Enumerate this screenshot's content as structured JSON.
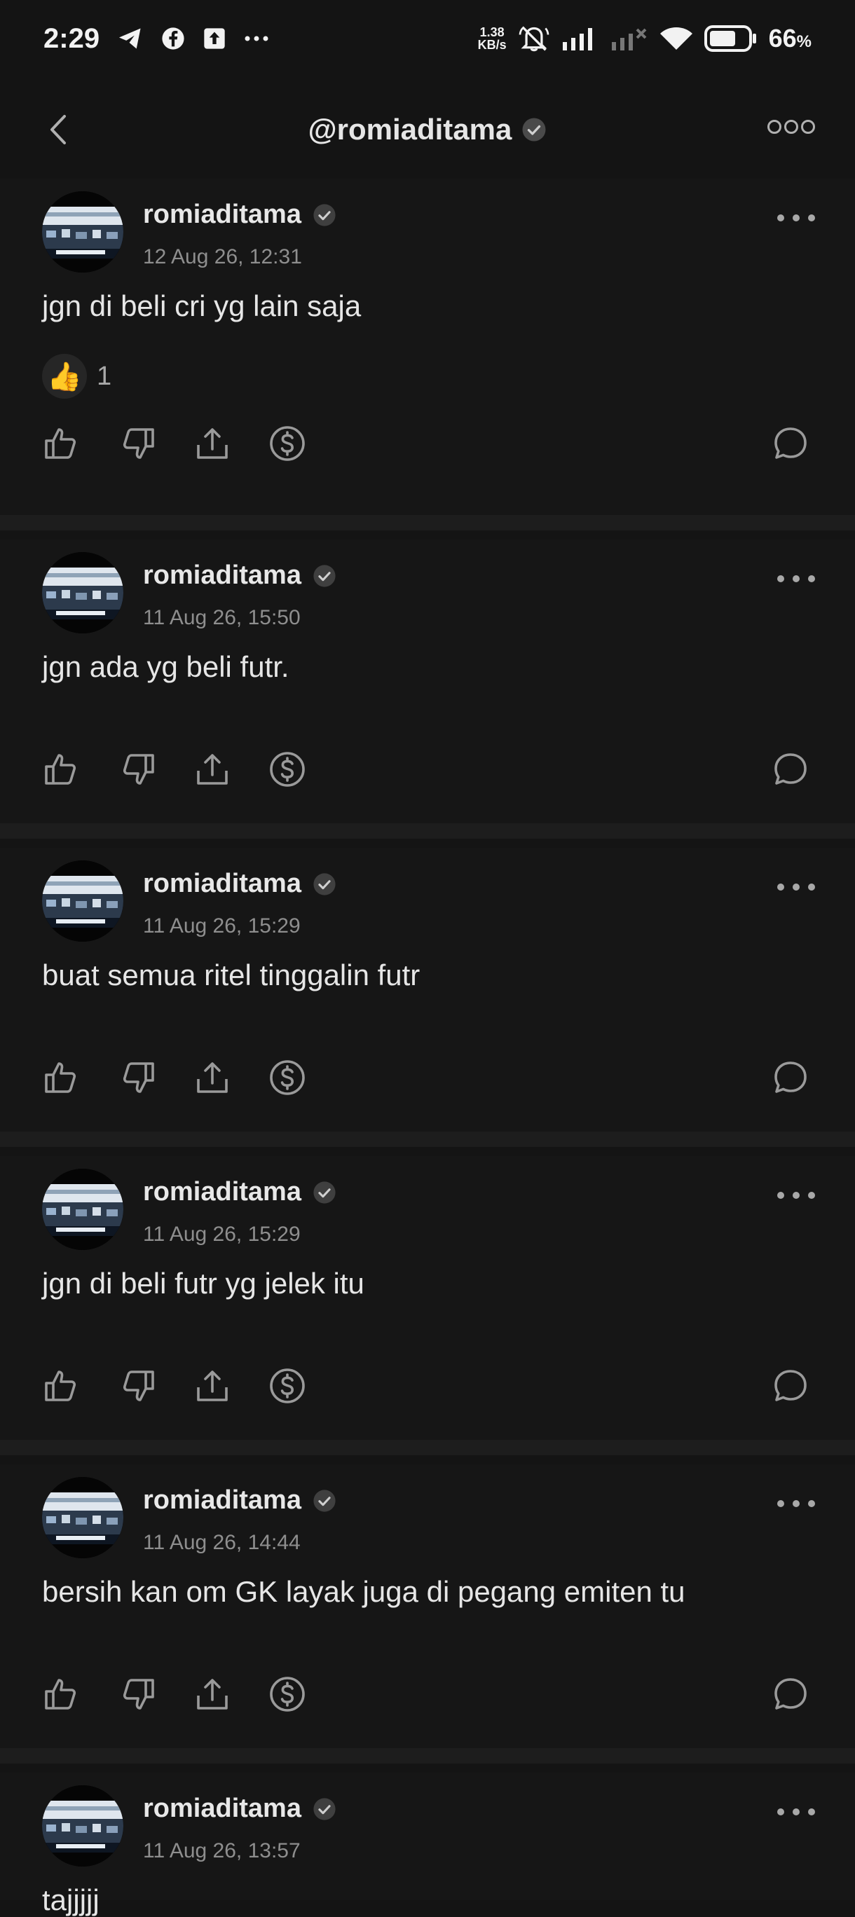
{
  "status_bar": {
    "time": "2:29",
    "net_speed_value": "1.38",
    "net_speed_unit": "KB/s",
    "battery_percent": "66",
    "battery_percent_sign": "%",
    "left_icons": [
      "telegram-icon",
      "facebook-icon",
      "upload-icon",
      "more-notifications-icon"
    ],
    "right_icons": [
      "mute-icon",
      "signal-icon",
      "signal-off-icon",
      "wifi-icon",
      "battery-icon"
    ]
  },
  "header": {
    "title": "@romiaditama",
    "back_icon": "chevron-left-icon",
    "verified_icon": "verified-check-icon",
    "more_icon": "more-circles-icon"
  },
  "posts": [
    {
      "username": "romiaditama",
      "timestamp": "12 Aug 26, 12:31",
      "text": "jgn di beli cri yg lain saja",
      "reaction_emoji": "👍",
      "reaction_count": "1"
    },
    {
      "username": "romiaditama",
      "timestamp": "11 Aug 26, 15:50",
      "text": "jgn ada yg beli futr."
    },
    {
      "username": "romiaditama",
      "timestamp": "11 Aug 26, 15:29",
      "text": "buat semua ritel tinggalin futr"
    },
    {
      "username": "romiaditama",
      "timestamp": "11 Aug 26, 15:29",
      "text": "jgn di beli futr yg jelek itu"
    },
    {
      "username": "romiaditama",
      "timestamp": "11 Aug 26, 14:44",
      "text": "bersih kan om GK layak juga di pegang emiten tu"
    },
    {
      "username": "romiaditama",
      "timestamp": "11 Aug 26, 13:57",
      "text": "tajjjjj"
    }
  ],
  "action_icons": [
    "like-icon",
    "dislike-icon",
    "share-icon",
    "tip-dollar-icon",
    "comment-icon"
  ],
  "colors": {
    "background": "#141414",
    "separator": "#1d1d1d",
    "text": "#e6e6e6",
    "muted": "#8e8e8e",
    "icon": "#9a9a9a"
  }
}
